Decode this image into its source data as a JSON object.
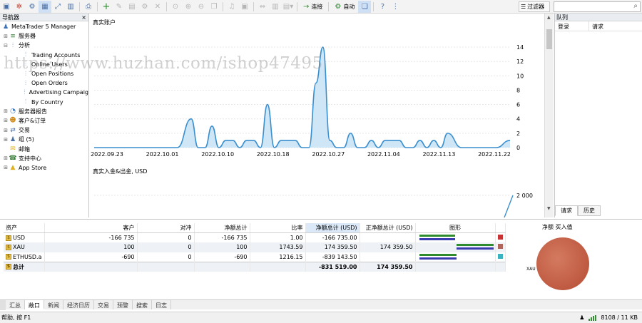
{
  "toolbar": {
    "connect_label": "连接",
    "auto_label": "自动",
    "filter_label": "过滤器",
    "search_placeholder": ""
  },
  "navigator": {
    "title": "导航器",
    "root": "MetaTrader 5 Manager",
    "items": [
      {
        "label": "服务器",
        "level": 1,
        "icon": "server-icon"
      },
      {
        "label": "分析",
        "level": 1,
        "icon": "analytics-icon"
      },
      {
        "label": "Trading Accounts",
        "level": 2,
        "icon": "report-icon"
      },
      {
        "label": "Online Users",
        "level": 2,
        "icon": "report-icon"
      },
      {
        "label": "Open Positions",
        "level": 2,
        "icon": "report-icon"
      },
      {
        "label": "Open Orders",
        "level": 2,
        "icon": "report-icon"
      },
      {
        "label": "Advertising Campaig",
        "level": 2,
        "icon": "report-icon"
      },
      {
        "label": "By Country",
        "level": 2,
        "icon": "report-icon"
      },
      {
        "label": "服务器报告",
        "level": 1,
        "icon": "server-report-icon"
      },
      {
        "label": "客户&订单",
        "level": 1,
        "icon": "clients-icon"
      },
      {
        "label": "交易",
        "level": 1,
        "icon": "trade-icon"
      },
      {
        "label": "组 (5)",
        "level": 1,
        "icon": "groups-icon"
      },
      {
        "label": "邮箱",
        "level": 1,
        "icon": "mail-icon"
      },
      {
        "label": "支持中心",
        "level": 1,
        "icon": "support-icon"
      },
      {
        "label": "App Store",
        "level": 1,
        "icon": "app-store-icon"
      }
    ]
  },
  "chart": {
    "title": "真实账户",
    "second_title": "真实入金&出金, USD",
    "second_tick": "2 000"
  },
  "chart_data": {
    "type": "area",
    "title": "真实账户",
    "x_tick_labels": [
      "2022.09.23",
      "2022.10.01",
      "2022.10.10",
      "2022.10.18",
      "2022.10.27",
      "2022.11.04",
      "2022.11.13",
      "2022.11.22"
    ],
    "y_ticks": [
      0,
      2,
      4,
      6,
      8,
      10,
      12,
      14
    ],
    "ylim": [
      0,
      15
    ],
    "x": [
      "2022.09.23",
      "2022.09.27",
      "2022.10.01",
      "2022.10.05",
      "2022.10.07",
      "2022.10.08",
      "2022.10.09",
      "2022.10.10",
      "2022.10.11",
      "2022.10.12",
      "2022.10.13",
      "2022.10.14",
      "2022.10.15",
      "2022.10.16",
      "2022.10.17",
      "2022.10.18",
      "2022.10.19",
      "2022.10.20",
      "2022.10.21",
      "2022.10.22",
      "2022.10.23",
      "2022.10.24",
      "2022.10.25",
      "2022.10.26",
      "2022.10.27",
      "2022.10.28",
      "2022.10.29",
      "2022.10.30",
      "2022.10.31",
      "2022.11.01",
      "2022.11.02",
      "2022.11.03",
      "2022.11.04",
      "2022.11.05",
      "2022.11.06",
      "2022.11.07",
      "2022.11.08",
      "2022.11.09",
      "2022.11.10",
      "2022.11.11",
      "2022.11.12",
      "2022.11.13",
      "2022.11.15",
      "2022.11.18",
      "2022.11.20",
      "2022.11.22"
    ],
    "values": [
      0,
      0,
      0,
      0,
      4,
      0,
      0,
      3,
      0,
      1,
      1,
      0,
      1,
      1,
      0,
      6,
      0,
      1,
      1,
      1,
      0,
      0,
      9,
      14,
      1,
      0,
      0,
      2,
      0,
      0,
      1,
      0,
      1,
      1,
      1,
      0,
      0,
      1,
      0,
      1,
      0,
      2,
      0,
      0,
      0,
      1
    ],
    "grid": true
  },
  "queue": {
    "title": "队列",
    "col_login": "登录",
    "col_request": "请求",
    "tab_request": "请求",
    "tab_history": "历史"
  },
  "exposure": {
    "headers": [
      "资产",
      "客户",
      "对冲",
      "净额总计",
      "比率",
      "净额总计 (USD)",
      "正净额总计 (USD)",
      "图形"
    ],
    "rows": [
      {
        "asset": "USD",
        "clients": "-166 735",
        "hedge": "0",
        "net": "-166 735",
        "rate": "1.00",
        "net_usd": "-166 735.00",
        "pos_usd": "",
        "swatch": "#c83232"
      },
      {
        "asset": "XAU",
        "clients": "100",
        "hedge": "0",
        "net": "100",
        "rate": "1743.59",
        "net_usd": "174 359.50",
        "pos_usd": "174 359.50",
        "swatch": "#b0655a"
      },
      {
        "asset": "ETHUSD.a",
        "clients": "-690",
        "hedge": "0",
        "net": "-690",
        "rate": "1216.15",
        "net_usd": "-839 143.50",
        "pos_usd": "",
        "swatch": "#3ab3c0"
      }
    ],
    "total": {
      "asset": "总计",
      "net_usd": "-831 519.00",
      "pos_usd": "174 359.50"
    },
    "pie_title": "净额 买入值",
    "pie_label": "XAU",
    "pie_color": "#c05a3f"
  },
  "tabs": [
    "汇总",
    "敞口",
    "新闻",
    "经济日历",
    "交易",
    "预警",
    "搜索",
    "日志"
  ],
  "active_tab": "敞口",
  "status": {
    "help": "帮助, 按 F1",
    "traffic": "8108 / 11 KB"
  },
  "watermark": "https://www.huzhan.com/ishop47495"
}
